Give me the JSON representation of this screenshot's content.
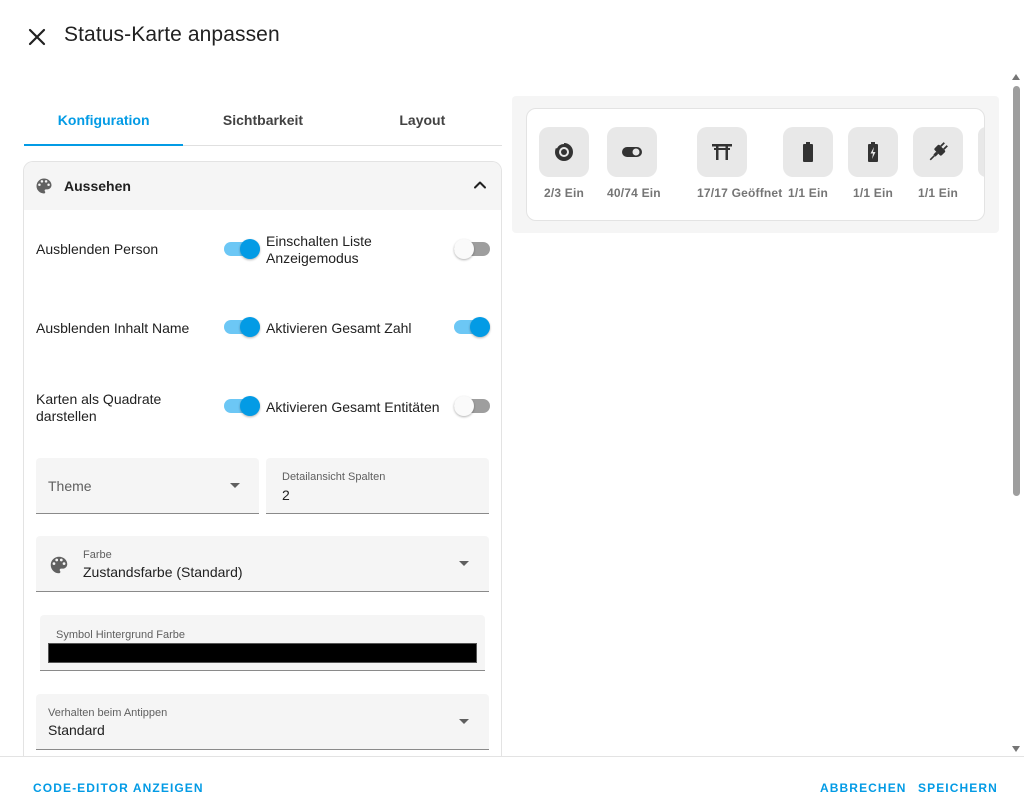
{
  "dialog": {
    "title": "Status-Karte anpassen"
  },
  "tabs": [
    {
      "label": "Konfiguration",
      "active": true
    },
    {
      "label": "Sichtbarkeit",
      "active": false
    },
    {
      "label": "Layout",
      "active": false
    }
  ],
  "section": {
    "title": "Aussehen",
    "expanded": true
  },
  "toggles": {
    "hide_person": {
      "label": "Ausblenden Person",
      "on": true
    },
    "list_mode": {
      "label_line1": "Einschalten Liste",
      "label_line2": "Anzeigemodus",
      "on": false
    },
    "hide_content_name": {
      "label": "Ausblenden Inhalt Name",
      "on": true
    },
    "total_count": {
      "label": "Aktivieren Gesamt Zahl",
      "on": true
    },
    "square_cards": {
      "label_line1": "Karten als Quadrate",
      "label_line2": "darstellen",
      "on": true
    },
    "total_entities": {
      "label": "Aktivieren Gesamt Entitäten",
      "on": false
    }
  },
  "fields": {
    "theme": {
      "placeholder": "Theme"
    },
    "detail_columns": {
      "label": "Detailansicht Spalten",
      "value": "2"
    },
    "color": {
      "label": "Farbe",
      "value": "Zustandsfarbe (Standard)"
    },
    "icon_bg_color": {
      "label": "Symbol Hintergrund Farbe",
      "value": "#000000"
    },
    "tap_action": {
      "label": "Verhalten beim Antippen",
      "value": "Standard"
    }
  },
  "preview": {
    "tiles": [
      {
        "icon": "robot-vacuum-icon",
        "label": "2/3 Ein"
      },
      {
        "icon": "toggle-switch-icon",
        "label": "40/74 Ein"
      },
      {
        "icon": "gate-icon",
        "label": "17/17 Geöffnet"
      },
      {
        "icon": "battery-icon",
        "label": "1/1 Ein"
      },
      {
        "icon": "battery-charging-icon",
        "label": "1/1 Ein"
      },
      {
        "icon": "power-plug-icon",
        "label": "1/1 Ein"
      }
    ]
  },
  "footer": {
    "code_editor": "CODE-EDITOR ANZEIGEN",
    "cancel": "ABBRECHEN",
    "save": "SPEICHERN"
  },
  "colors": {
    "accent": "#039be5",
    "accent_light": "#6cc7f5"
  }
}
